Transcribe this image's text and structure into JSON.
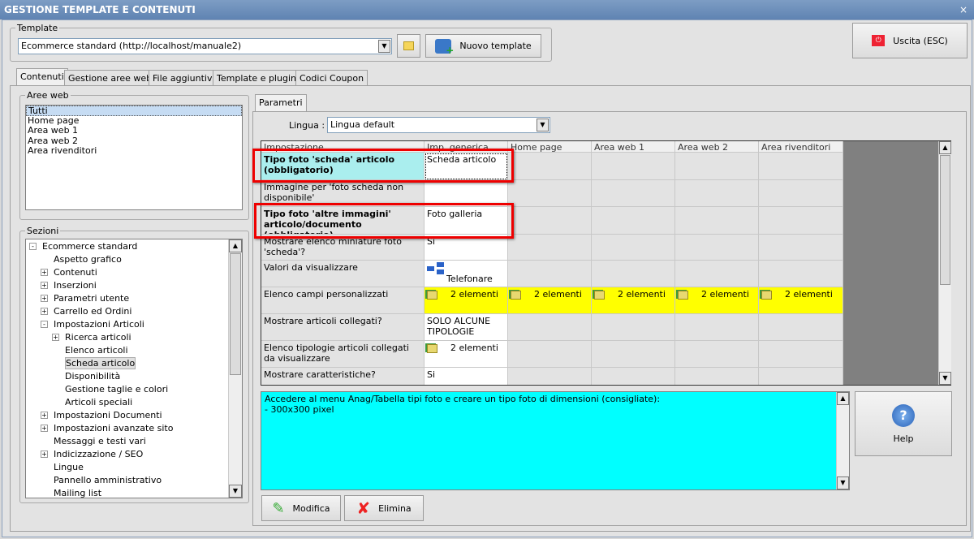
{
  "window": {
    "title": "GESTIONE TEMPLATE E CONTENUTI",
    "close": "×"
  },
  "template": {
    "legend": "Template",
    "selected": "Ecommerce standard (http://localhost/manuale2)",
    "new_button": "Nuovo template"
  },
  "exit_button": "Uscita (ESC)",
  "tabs": [
    "Contenuti",
    "Gestione aree web",
    "File aggiuntivi",
    "Template e plugins",
    "Codici Coupon"
  ],
  "aree_web": {
    "legend": "Aree web",
    "items": [
      "Tutti",
      "Home page",
      "Area web 1",
      "Area web 2",
      "Area rivenditori"
    ]
  },
  "sezioni": {
    "legend": "Sezioni",
    "items": [
      {
        "label": "Ecommerce standard",
        "level": 0,
        "exp": "-"
      },
      {
        "label": "Aspetto grafico",
        "level": 1,
        "exp": ""
      },
      {
        "label": "Contenuti",
        "level": 1,
        "exp": "+"
      },
      {
        "label": "Inserzioni",
        "level": 1,
        "exp": "+"
      },
      {
        "label": "Parametri utente",
        "level": 1,
        "exp": "+"
      },
      {
        "label": "Carrello ed Ordini",
        "level": 1,
        "exp": "+"
      },
      {
        "label": "Impostazioni Articoli",
        "level": 1,
        "exp": "-"
      },
      {
        "label": "Ricerca articoli",
        "level": 2,
        "exp": "+"
      },
      {
        "label": "Elenco articoli",
        "level": 2,
        "exp": ""
      },
      {
        "label": "Scheda articolo",
        "level": 2,
        "exp": "",
        "selected": true
      },
      {
        "label": "Disponibilità",
        "level": 2,
        "exp": ""
      },
      {
        "label": "Gestione taglie e colori",
        "level": 2,
        "exp": ""
      },
      {
        "label": "Articoli speciali",
        "level": 2,
        "exp": ""
      },
      {
        "label": "Impostazioni Documenti",
        "level": 1,
        "exp": "+"
      },
      {
        "label": "Impostazioni avanzate sito",
        "level": 1,
        "exp": "+"
      },
      {
        "label": "Messaggi e testi vari",
        "level": 1,
        "exp": ""
      },
      {
        "label": "Indicizzazione / SEO",
        "level": 1,
        "exp": "+"
      },
      {
        "label": "Lingue",
        "level": 1,
        "exp": ""
      },
      {
        "label": "Pannello amministrativo",
        "level": 1,
        "exp": ""
      },
      {
        "label": "Mailing list",
        "level": 1,
        "exp": ""
      }
    ]
  },
  "parametri": {
    "tab": "Parametri",
    "lingua_label": "Lingua :",
    "lingua_value": "Lingua default",
    "columns": [
      "Impostazione",
      "Imp. generica",
      "Home page",
      "Area web 1",
      "Area web 2",
      "Area rivenditori"
    ],
    "rows": [
      {
        "label": "Tipo foto 'scheda' articolo (obbligatorio)",
        "bold": true,
        "hl": true,
        "values": [
          "Scheda articolo",
          "",
          "",
          "",
          "",
          ""
        ]
      },
      {
        "label": "Immagine per 'foto scheda non disponibile'",
        "values": [
          "",
          "",
          "",
          "",
          "",
          ""
        ]
      },
      {
        "label": "Tipo foto 'altre immagini' articolo/documento (obbligatorio)",
        "bold": true,
        "values": [
          "Foto galleria",
          "",
          "",
          "",
          "",
          ""
        ]
      },
      {
        "label": "Mostrare elenco miniature foto 'scheda'?",
        "values": [
          "Si",
          "",
          "",
          "",
          "",
          ""
        ]
      },
      {
        "label": "Valori da visualizzare",
        "values": [
          "Telefonare p...",
          "",
          "",
          "",
          "",
          ""
        ],
        "tree": true
      },
      {
        "label": "Elenco campi personalizzati",
        "values": [
          "2 elementi",
          "2 elementi",
          "2 elementi",
          "2 elementi",
          "2 elementi"
        ],
        "folder": true,
        "yellow": true
      },
      {
        "label": "Mostrare articoli collegati?",
        "values": [
          "SOLO ALCUNE TIPOLOGIE",
          "",
          "",
          "",
          "",
          ""
        ]
      },
      {
        "label": "Elenco tipologie articoli collegati da visualizzare",
        "values": [
          "2 elementi"
        ],
        "folder": true
      },
      {
        "label": "Mostrare caratteristiche?",
        "values": [
          "Si"
        ]
      }
    ]
  },
  "info_text": "Accedere al menu Anag/Tabella tipi foto e creare un tipo foto di dimensioni (consigliate):\n- 300x300 pixel",
  "help_button": "Help",
  "modifica_button": "Modifica",
  "elimina_button": "Elimina",
  "colors": {
    "highlight": "#aaeeee",
    "yellow": "#ffff00",
    "info_bg": "#00ffff",
    "red_box": "#ee0000"
  }
}
